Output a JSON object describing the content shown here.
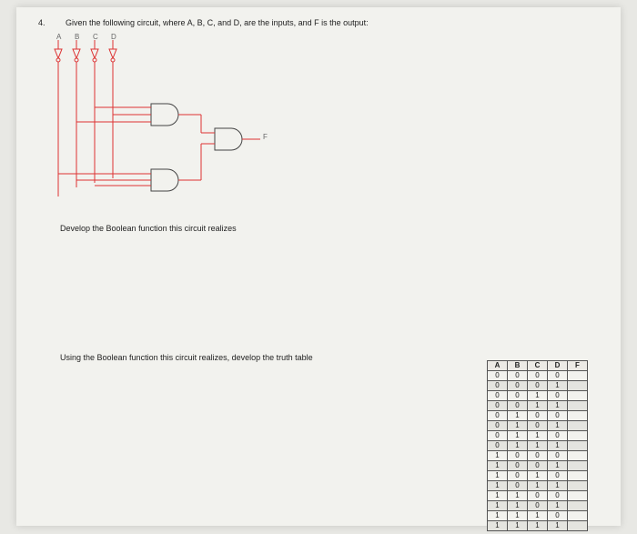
{
  "question_number": "4.",
  "question_text": "Given the following circuit, where A, B, C, and D, are the inputs, and F is the output:",
  "prompt_boolean": "Develop the Boolean function this circuit realizes",
  "prompt_truth": "Using the Boolean function this circuit realizes, develop the truth table",
  "circuit": {
    "inputs": [
      "A",
      "B",
      "C",
      "D"
    ],
    "output": "F"
  },
  "truth_table": {
    "headers": [
      "A",
      "B",
      "C",
      "D",
      "F"
    ],
    "rows": [
      [
        "0",
        "0",
        "0",
        "0",
        ""
      ],
      [
        "0",
        "0",
        "0",
        "1",
        ""
      ],
      [
        "0",
        "0",
        "1",
        "0",
        ""
      ],
      [
        "0",
        "0",
        "1",
        "1",
        ""
      ],
      [
        "0",
        "1",
        "0",
        "0",
        ""
      ],
      [
        "0",
        "1",
        "0",
        "1",
        ""
      ],
      [
        "0",
        "1",
        "1",
        "0",
        ""
      ],
      [
        "0",
        "1",
        "1",
        "1",
        ""
      ],
      [
        "1",
        "0",
        "0",
        "0",
        ""
      ],
      [
        "1",
        "0",
        "0",
        "1",
        ""
      ],
      [
        "1",
        "0",
        "1",
        "0",
        ""
      ],
      [
        "1",
        "0",
        "1",
        "1",
        ""
      ],
      [
        "1",
        "1",
        "0",
        "0",
        ""
      ],
      [
        "1",
        "1",
        "0",
        "1",
        ""
      ],
      [
        "1",
        "1",
        "1",
        "0",
        ""
      ],
      [
        "1",
        "1",
        "1",
        "1",
        ""
      ]
    ]
  }
}
